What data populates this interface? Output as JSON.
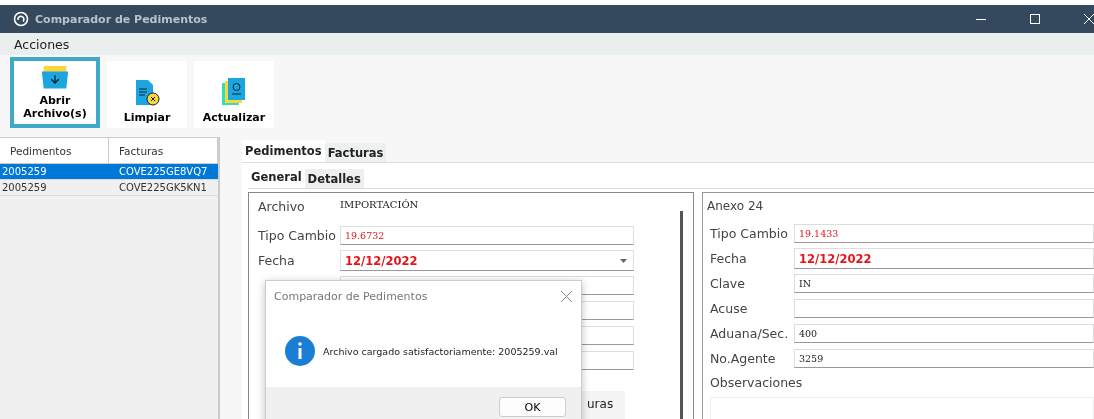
{
  "window": {
    "title": "Comparador de Pedimentos"
  },
  "menu": [
    "Acciones"
  ],
  "toolbar": [
    {
      "label": "Abrir Archivo(s)",
      "selected": true
    },
    {
      "label": "Limpiar",
      "selected": false
    },
    {
      "label": "Actualizar",
      "selected": false
    }
  ],
  "grid": {
    "columns": [
      "Pedimentos",
      "Facturas"
    ],
    "rows": [
      {
        "cells": [
          "2005259",
          "COVE225GE8VQ7"
        ],
        "selected": true
      },
      {
        "cells": [
          "2005259",
          "COVE225GK5KN1"
        ],
        "selected": false
      }
    ]
  },
  "tabs": [
    {
      "label": "Pedimentos",
      "selected": true
    },
    {
      "label": "Facturas",
      "selected": false
    }
  ],
  "subtabs": [
    {
      "label": "General",
      "selected": true
    },
    {
      "label": "Detalles",
      "selected": false
    }
  ],
  "general": {
    "fields": [
      {
        "label": "Archivo",
        "value": "IMPORTACIÓN",
        "kind": "text"
      },
      {
        "label": "Tipo Cambio",
        "value": "19.6732",
        "kind": "alert"
      },
      {
        "label": "Fecha",
        "value": "12/12/2022",
        "kind": "date-picker"
      },
      {
        "kind": "input"
      },
      {
        "kind": "input"
      },
      {
        "kind": "input"
      },
      {
        "kind": "input"
      }
    ],
    "inner_tab": "uras"
  },
  "anexo": {
    "title": "Anexo 24",
    "fields": [
      {
        "label": "Tipo Cambio",
        "value": "19.1433",
        "kind": "alert"
      },
      {
        "label": "Fecha",
        "value": "12/12/2022",
        "kind": "date"
      },
      {
        "label": "Clave",
        "value": "IN",
        "kind": "input"
      },
      {
        "label": "Acuse",
        "kind": "input"
      },
      {
        "label": "Aduana/Sec.",
        "value": "400",
        "kind": "input"
      },
      {
        "label": "No.Agente",
        "value": "3259",
        "kind": "input"
      }
    ],
    "notes_label": "Observaciones"
  },
  "dialog": {
    "title": "Comparador de Pedimentos",
    "message": "Archivo cargado satisfactoriamente: 2005259.val",
    "button": "OK"
  }
}
